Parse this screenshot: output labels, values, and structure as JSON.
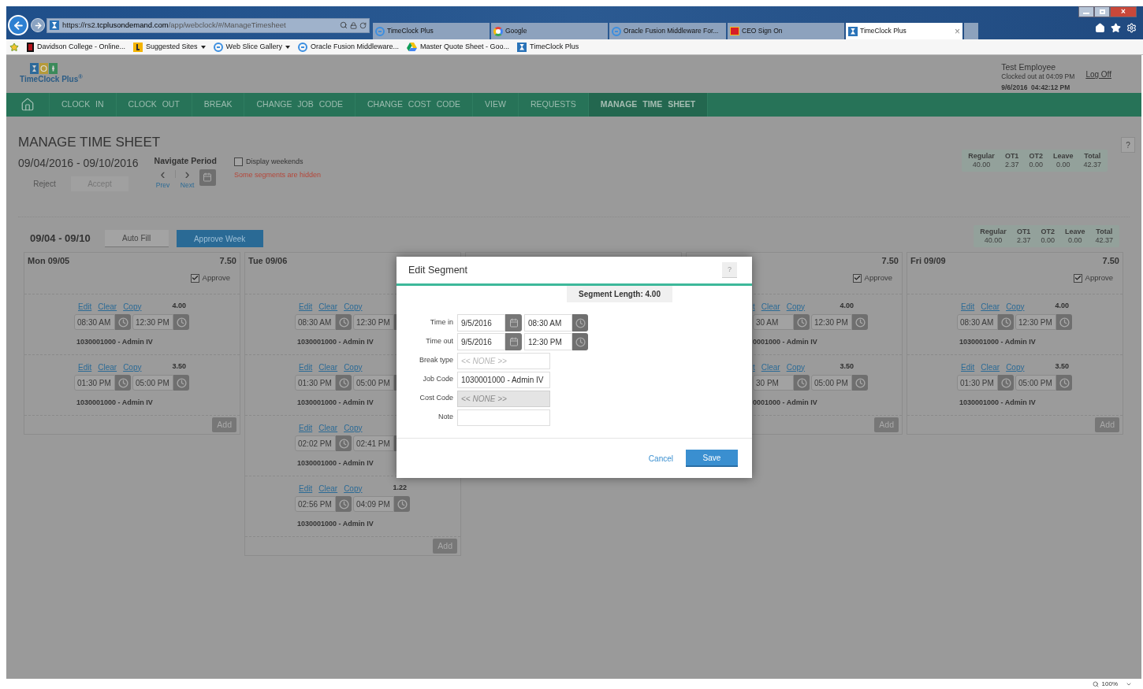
{
  "browser": {
    "url": {
      "host_prefix": "https://rs2.",
      "domain": "tcplusondemand.com",
      "path": "/app/webclock/#/ManageTimesheet"
    },
    "tabs": [
      {
        "title": "TimeClock Plus",
        "kind": "ie",
        "selected": false
      },
      {
        "title": "Google",
        "kind": "google",
        "selected": false
      },
      {
        "title": "Oracle Fusion Middleware For...",
        "kind": "ie",
        "selected": false
      },
      {
        "title": "CEO Sign On",
        "kind": "wf",
        "selected": false
      },
      {
        "title": "TimeClock Plus",
        "kind": "timeclock",
        "selected": true
      }
    ],
    "close_tab": "×",
    "favorites": [
      {
        "label": "Davidson College - Online...",
        "kind": "college",
        "has_menu": false
      },
      {
        "label": "Suggested Sites",
        "kind": "bing",
        "has_menu": true
      },
      {
        "label": "Web Slice Gallery",
        "kind": "ie",
        "has_menu": true
      },
      {
        "label": "Oracle Fusion Middleware...",
        "kind": "ie",
        "has_menu": false
      },
      {
        "label": "Master Quote Sheet - Goo...",
        "kind": "drive",
        "has_menu": false
      },
      {
        "label": "TimeClock Plus",
        "kind": "timeclock",
        "has_menu": false
      }
    ],
    "zoom": "100%"
  },
  "header": {
    "logo_text": "TimeClock Plus$^{®}$",
    "user": "Test Employee",
    "status": "Clocked out at 04:09 PM",
    "datetime": "9/6/2016  04:42:12 PM",
    "log_off": "Log Off"
  },
  "nav": [
    {
      "label": "CLOCK IN",
      "selected": false
    },
    {
      "label": "CLOCK OUT",
      "selected": false
    },
    {
      "label": "BREAK",
      "selected": false
    },
    {
      "label": "CHANGE JOB CODE",
      "selected": false
    },
    {
      "label": "CHANGE COST CODE",
      "selected": false
    },
    {
      "label": "VIEW",
      "selected": false
    },
    {
      "label": "REQUESTS",
      "selected": false
    },
    {
      "label": "MANAGE TIME SHEET",
      "selected": true
    }
  ],
  "page": {
    "title": "MANAGE TIME SHEET",
    "help": "?",
    "period": "09/04/2016 - 09/10/2016",
    "reject": "Reject",
    "accept": "Accept",
    "navigate_label": "Navigate Period",
    "prev_arrow": "‹",
    "next_arrow": "›",
    "prev": "Prev",
    "next": "Next",
    "display_weekends": {
      "label": "Display weekends",
      "checked": false
    },
    "warning": "Some segments are hidden",
    "summary": [
      {
        "label": "Regular",
        "value": "40.00"
      },
      {
        "label": "OT1",
        "value": "2.37"
      },
      {
        "label": "OT2",
        "value": "0.00"
      },
      {
        "label": "Leave",
        "value": "0.00"
      },
      {
        "label": "Total",
        "value": "42.37"
      }
    ]
  },
  "week": {
    "range": "09/04 - 09/10",
    "auto_fill": "Auto Fill",
    "approve_week": "Approve Week",
    "summary": [
      {
        "label": "Regular",
        "value": "40.00"
      },
      {
        "label": "OT1",
        "value": "2.37"
      },
      {
        "label": "OT2",
        "value": "0.00"
      },
      {
        "label": "Leave",
        "value": "0.00"
      },
      {
        "label": "Total",
        "value": "42.37"
      }
    ]
  },
  "days": [
    {
      "kind": "full",
      "label": "Mon 09/05",
      "total": "7.50",
      "approve": {
        "label": "Approve",
        "checked": true
      },
      "add": "Add",
      "segments": [
        {
          "edit": "Edit",
          "clear": "Clear",
          "copy": "Copy",
          "hours": "4.00",
          "start": "08:30 AM",
          "end": "12:30 PM",
          "job": "1030001000 - Admin IV"
        },
        {
          "edit": "Edit",
          "clear": "Clear",
          "copy": "Copy",
          "hours": "3.50",
          "start": "01:30 PM",
          "end": "05:00 PM",
          "job": "1030001000 - Admin IV"
        }
      ]
    },
    {
      "kind": "full",
      "label": "Tue 09/06",
      "add": "Add",
      "segments": [
        {
          "edit": "Edit",
          "clear": "Clear",
          "copy": "Copy",
          "start": "08:30 AM",
          "end": "12:30 PM",
          "job": "1030001000 - Admin IV"
        },
        {
          "edit": "Edit",
          "clear": "Clear",
          "copy": "Copy",
          "start": "01:30 PM",
          "end": "05:00 PM",
          "job": "1030001000 - Admin IV"
        },
        {
          "edit": "Edit",
          "clear": "Clear",
          "copy": "Copy",
          "start": "02:02 PM",
          "end": "02:41 PM",
          "job": "1030001000 - Admin IV"
        },
        {
          "edit": "Edit",
          "clear": "Clear",
          "copy": "Copy",
          "hours": "1.22",
          "start": "02:56 PM",
          "end": "04:09 PM",
          "job": "1030001000 - Admin IV"
        }
      ]
    },
    {
      "kind": "covered"
    },
    {
      "kind": "partial",
      "total": "7.50",
      "approve": {
        "label": "Approve",
        "checked": true
      },
      "add": "Add",
      "segments": [
        {
          "edit": "t",
          "clear": "Clear",
          "copy": "Copy",
          "hours": "4.00",
          "start": "30 AM",
          "end": "12:30 PM",
          "job": "0001000 - Admin IV"
        },
        {
          "edit": "t",
          "clear": "Clear",
          "copy": "Copy",
          "hours": "3.50",
          "start": "30 PM",
          "end": "05:00 PM",
          "job": "0001000 - Admin IV"
        }
      ]
    },
    {
      "kind": "full",
      "label": "Fri 09/09",
      "total": "7.50",
      "approve": {
        "label": "Approve",
        "checked": true
      },
      "add": "Add",
      "segments": [
        {
          "edit": "Edit",
          "clear": "Clear",
          "copy": "Copy",
          "hours": "4.00",
          "start": "08:30 AM",
          "end": "12:30 PM",
          "job": "1030001000 - Admin IV"
        },
        {
          "edit": "Edit",
          "clear": "Clear",
          "copy": "Copy",
          "hours": "3.50",
          "start": "01:30 PM",
          "end": "05:00 PM",
          "job": "1030001000 - Admin IV"
        }
      ]
    }
  ],
  "modal": {
    "title": "Edit Segment",
    "help": "?",
    "segment_length": "Segment Length: 4.00",
    "fields": [
      {
        "kind": "datetime",
        "label": "Time in",
        "date": "9/5/2016",
        "time": "08:30 AM"
      },
      {
        "kind": "datetime",
        "label": "Time out",
        "date": "9/5/2016",
        "time": "12:30 PM"
      },
      {
        "kind": "select",
        "label": "Break type",
        "placeholder": "<< NONE >>",
        "disabled": false
      },
      {
        "kind": "select",
        "label": "Job Code",
        "value": "1030001000 - Admin IV",
        "disabled": false
      },
      {
        "kind": "select",
        "label": "Cost Code",
        "placeholder": "<< NONE >>",
        "disabled": true
      },
      {
        "kind": "text",
        "label": "Note"
      }
    ],
    "cancel": "Cancel",
    "save": "Save"
  }
}
